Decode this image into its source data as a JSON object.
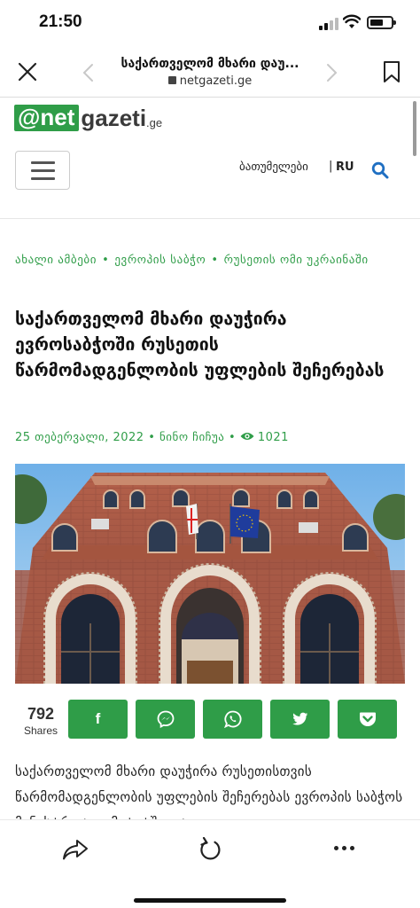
{
  "status_bar": {
    "time": "21:50"
  },
  "browser": {
    "page_title": "საქართველომ მხარი დაუ...",
    "domain": "netgazeti.ge",
    "icons": [
      "close-icon",
      "back-chevron-icon",
      "forward-chevron-icon",
      "lock-icon",
      "bookmark-icon"
    ]
  },
  "site": {
    "logo_badge": "@net",
    "logo_rest": "gazeti",
    "logo_tld": ".ge",
    "city": "ბათუმელები",
    "separator": "|",
    "language": "RU",
    "colors": {
      "brand_green": "#2f9d48",
      "search_blue": "#1f6fc2"
    }
  },
  "article": {
    "categories": [
      "ახალი ამბები",
      "ევროპის საბჭო",
      "რუსეთის ომი უკრაინაში"
    ],
    "title": "საქართველომ მხარი დაუჭირა ევროსაბჭოში რუსეთის წარმომადგენლობის უფლების შეჩერებას",
    "date": "25 თებერვალი, 2022",
    "author": "ნინო ჩიჩუა",
    "views": "1021",
    "photo_alt": "Building with Georgian and EU flags",
    "body_excerpt": "საქართველომ მხარი დაუჭირა რუსეთისთვის წარმომადგენლობის უფლების შეჩერებას ევროპის საბჭოს მინისტრთა კომიტეტში და"
  },
  "share": {
    "count": "792",
    "label": "Shares",
    "buttons": [
      {
        "name": "facebook",
        "label": "f"
      },
      {
        "name": "messenger",
        "label": ""
      },
      {
        "name": "whatsapp",
        "label": ""
      },
      {
        "name": "twitter",
        "label": ""
      },
      {
        "name": "pocket",
        "label": ""
      }
    ]
  },
  "toolbar": {
    "icons": [
      "share-icon",
      "reload-icon",
      "more-icon"
    ]
  }
}
